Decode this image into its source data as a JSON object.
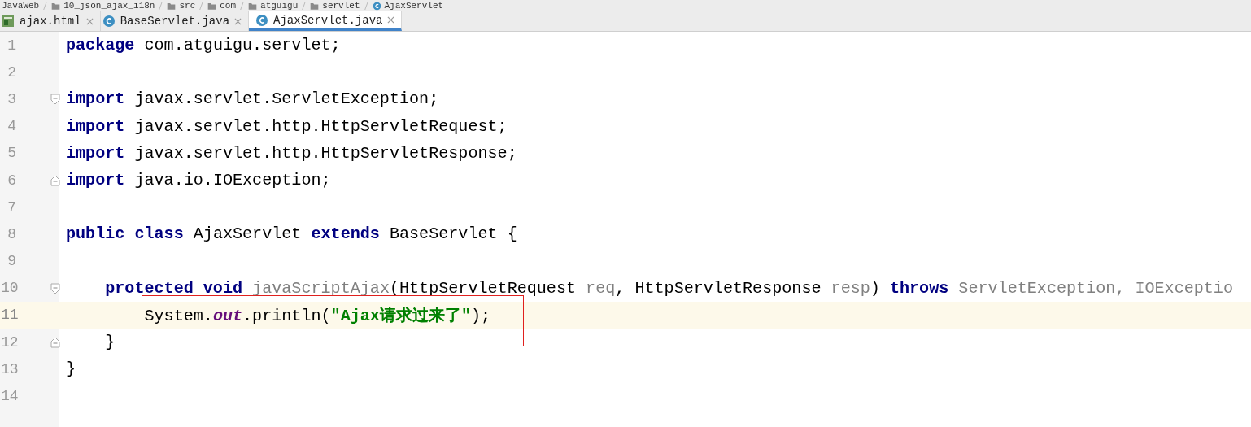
{
  "breadcrumbs": [
    "JavaWeb",
    "10_json_ajax_i18n",
    "src",
    "com",
    "atguigu",
    "servlet",
    "AjaxServlet"
  ],
  "tabs": [
    {
      "label": "ajax.html",
      "kind": "html",
      "selected": false
    },
    {
      "label": "BaseServlet.java",
      "kind": "class",
      "selected": false
    },
    {
      "label": "AjaxServlet.java",
      "kind": "class",
      "selected": true
    }
  ],
  "editor": {
    "highlight_box": true,
    "lines": [
      {
        "number": "1",
        "current": false,
        "fold_start": false,
        "fold_end": false,
        "tokens": [
          {
            "kind": "keyword",
            "text": "package"
          },
          {
            "kind": "plain",
            "text": " com.atguigu.servlet;"
          }
        ]
      },
      {
        "number": "2",
        "current": false,
        "fold_start": false,
        "fold_end": false
      },
      {
        "number": "3",
        "current": false,
        "fold_start": true,
        "fold_end": false,
        "tokens": [
          {
            "kind": "keyword",
            "text": "import"
          },
          {
            "kind": "plain",
            "text": " javax.servlet.ServletException;"
          }
        ]
      },
      {
        "number": "4",
        "current": false,
        "fold_start": false,
        "fold_end": false,
        "tokens": [
          {
            "kind": "keyword",
            "text": "import"
          },
          {
            "kind": "plain",
            "text": " javax.servlet.http.HttpServletRequest;"
          }
        ]
      },
      {
        "number": "5",
        "current": false,
        "fold_start": false,
        "fold_end": false,
        "tokens": [
          {
            "kind": "keyword",
            "text": "import"
          },
          {
            "kind": "plain",
            "text": " javax.servlet.http.HttpServletResponse;"
          }
        ]
      },
      {
        "number": "6",
        "current": false,
        "fold_start": false,
        "fold_end": true,
        "tokens": [
          {
            "kind": "keyword",
            "text": "import"
          },
          {
            "kind": "plain",
            "text": " java.io.IOException;"
          }
        ]
      },
      {
        "number": "7",
        "current": false,
        "fold_start": false,
        "fold_end": false
      },
      {
        "number": "8",
        "current": false,
        "fold_start": false,
        "fold_end": false,
        "tokens": [
          {
            "kind": "keyword",
            "text": "public class"
          },
          {
            "kind": "plain",
            "text": " AjaxServlet "
          },
          {
            "kind": "keyword",
            "text": "extends"
          },
          {
            "kind": "plain",
            "text": " BaseServlet {"
          }
        ]
      },
      {
        "number": "9",
        "current": false,
        "fold_start": false,
        "fold_end": false
      },
      {
        "number": "10",
        "current": false,
        "fold_start": true,
        "fold_end": false,
        "tokens": [
          {
            "kind": "keyword",
            "text": "    protected void"
          },
          {
            "kind": "unused",
            "text": " javaScriptAjax"
          },
          {
            "kind": "plain",
            "text": "(HttpServletRequest "
          },
          {
            "kind": "unused",
            "text": "req"
          },
          {
            "kind": "plain",
            "text": ", HttpServletResponse "
          },
          {
            "kind": "unused",
            "text": "resp"
          },
          {
            "kind": "plain",
            "text": ") "
          },
          {
            "kind": "keyword",
            "text": "throws"
          },
          {
            "kind": "unused",
            "text": " ServletException, IOExceptio"
          }
        ]
      },
      {
        "number": "11",
        "current": true,
        "fold_start": false,
        "fold_end": false,
        "tokens": [
          {
            "kind": "plain",
            "text": "        System."
          },
          {
            "kind": "static",
            "text": "out"
          },
          {
            "kind": "plain",
            "text": ".println("
          },
          {
            "kind": "string",
            "text": "\"Ajax请求过来了\""
          },
          {
            "kind": "plain",
            "text": ");"
          }
        ]
      },
      {
        "number": "12",
        "current": false,
        "fold_start": false,
        "fold_end": true,
        "tokens": [
          {
            "kind": "plain",
            "text": "    }"
          }
        ]
      },
      {
        "number": "13",
        "current": false,
        "fold_start": false,
        "fold_end": false,
        "tokens": [
          {
            "kind": "plain",
            "text": "}"
          }
        ]
      },
      {
        "number": "14",
        "current": false,
        "fold_start": false,
        "fold_end": false
      }
    ]
  }
}
